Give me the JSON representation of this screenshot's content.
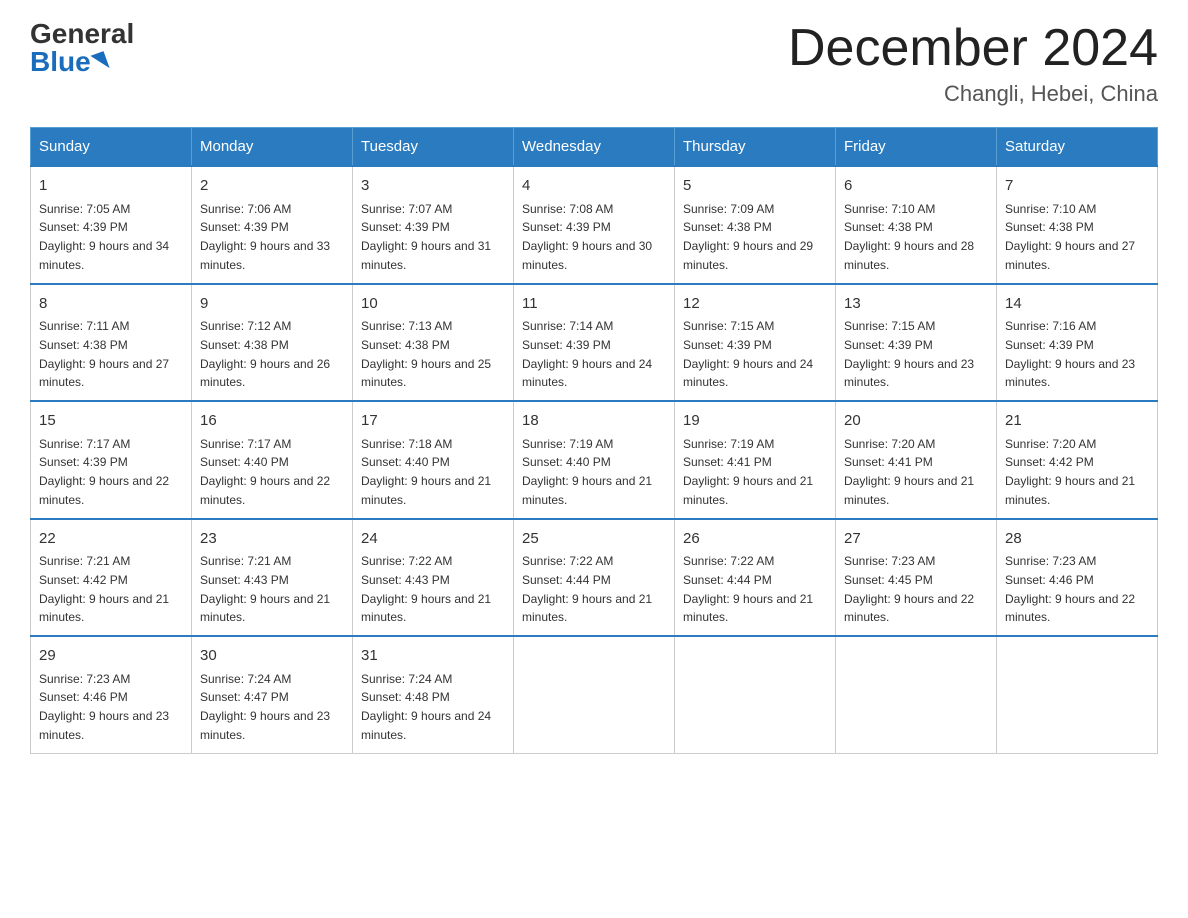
{
  "header": {
    "logo_general": "General",
    "logo_blue": "Blue",
    "month_title": "December 2024",
    "location": "Changli, Hebei, China"
  },
  "weekdays": [
    "Sunday",
    "Monday",
    "Tuesday",
    "Wednesday",
    "Thursday",
    "Friday",
    "Saturday"
  ],
  "weeks": [
    [
      {
        "day": "1",
        "sunrise": "7:05 AM",
        "sunset": "4:39 PM",
        "daylight": "9 hours and 34 minutes."
      },
      {
        "day": "2",
        "sunrise": "7:06 AM",
        "sunset": "4:39 PM",
        "daylight": "9 hours and 33 minutes."
      },
      {
        "day": "3",
        "sunrise": "7:07 AM",
        "sunset": "4:39 PM",
        "daylight": "9 hours and 31 minutes."
      },
      {
        "day": "4",
        "sunrise": "7:08 AM",
        "sunset": "4:39 PM",
        "daylight": "9 hours and 30 minutes."
      },
      {
        "day": "5",
        "sunrise": "7:09 AM",
        "sunset": "4:38 PM",
        "daylight": "9 hours and 29 minutes."
      },
      {
        "day": "6",
        "sunrise": "7:10 AM",
        "sunset": "4:38 PM",
        "daylight": "9 hours and 28 minutes."
      },
      {
        "day": "7",
        "sunrise": "7:10 AM",
        "sunset": "4:38 PM",
        "daylight": "9 hours and 27 minutes."
      }
    ],
    [
      {
        "day": "8",
        "sunrise": "7:11 AM",
        "sunset": "4:38 PM",
        "daylight": "9 hours and 27 minutes."
      },
      {
        "day": "9",
        "sunrise": "7:12 AM",
        "sunset": "4:38 PM",
        "daylight": "9 hours and 26 minutes."
      },
      {
        "day": "10",
        "sunrise": "7:13 AM",
        "sunset": "4:38 PM",
        "daylight": "9 hours and 25 minutes."
      },
      {
        "day": "11",
        "sunrise": "7:14 AM",
        "sunset": "4:39 PM",
        "daylight": "9 hours and 24 minutes."
      },
      {
        "day": "12",
        "sunrise": "7:15 AM",
        "sunset": "4:39 PM",
        "daylight": "9 hours and 24 minutes."
      },
      {
        "day": "13",
        "sunrise": "7:15 AM",
        "sunset": "4:39 PM",
        "daylight": "9 hours and 23 minutes."
      },
      {
        "day": "14",
        "sunrise": "7:16 AM",
        "sunset": "4:39 PM",
        "daylight": "9 hours and 23 minutes."
      }
    ],
    [
      {
        "day": "15",
        "sunrise": "7:17 AM",
        "sunset": "4:39 PM",
        "daylight": "9 hours and 22 minutes."
      },
      {
        "day": "16",
        "sunrise": "7:17 AM",
        "sunset": "4:40 PM",
        "daylight": "9 hours and 22 minutes."
      },
      {
        "day": "17",
        "sunrise": "7:18 AM",
        "sunset": "4:40 PM",
        "daylight": "9 hours and 21 minutes."
      },
      {
        "day": "18",
        "sunrise": "7:19 AM",
        "sunset": "4:40 PM",
        "daylight": "9 hours and 21 minutes."
      },
      {
        "day": "19",
        "sunrise": "7:19 AM",
        "sunset": "4:41 PM",
        "daylight": "9 hours and 21 minutes."
      },
      {
        "day": "20",
        "sunrise": "7:20 AM",
        "sunset": "4:41 PM",
        "daylight": "9 hours and 21 minutes."
      },
      {
        "day": "21",
        "sunrise": "7:20 AM",
        "sunset": "4:42 PM",
        "daylight": "9 hours and 21 minutes."
      }
    ],
    [
      {
        "day": "22",
        "sunrise": "7:21 AM",
        "sunset": "4:42 PM",
        "daylight": "9 hours and 21 minutes."
      },
      {
        "day": "23",
        "sunrise": "7:21 AM",
        "sunset": "4:43 PM",
        "daylight": "9 hours and 21 minutes."
      },
      {
        "day": "24",
        "sunrise": "7:22 AM",
        "sunset": "4:43 PM",
        "daylight": "9 hours and 21 minutes."
      },
      {
        "day": "25",
        "sunrise": "7:22 AM",
        "sunset": "4:44 PM",
        "daylight": "9 hours and 21 minutes."
      },
      {
        "day": "26",
        "sunrise": "7:22 AM",
        "sunset": "4:44 PM",
        "daylight": "9 hours and 21 minutes."
      },
      {
        "day": "27",
        "sunrise": "7:23 AM",
        "sunset": "4:45 PM",
        "daylight": "9 hours and 22 minutes."
      },
      {
        "day": "28",
        "sunrise": "7:23 AM",
        "sunset": "4:46 PM",
        "daylight": "9 hours and 22 minutes."
      }
    ],
    [
      {
        "day": "29",
        "sunrise": "7:23 AM",
        "sunset": "4:46 PM",
        "daylight": "9 hours and 23 minutes."
      },
      {
        "day": "30",
        "sunrise": "7:24 AM",
        "sunset": "4:47 PM",
        "daylight": "9 hours and 23 minutes."
      },
      {
        "day": "31",
        "sunrise": "7:24 AM",
        "sunset": "4:48 PM",
        "daylight": "9 hours and 24 minutes."
      },
      null,
      null,
      null,
      null
    ]
  ]
}
